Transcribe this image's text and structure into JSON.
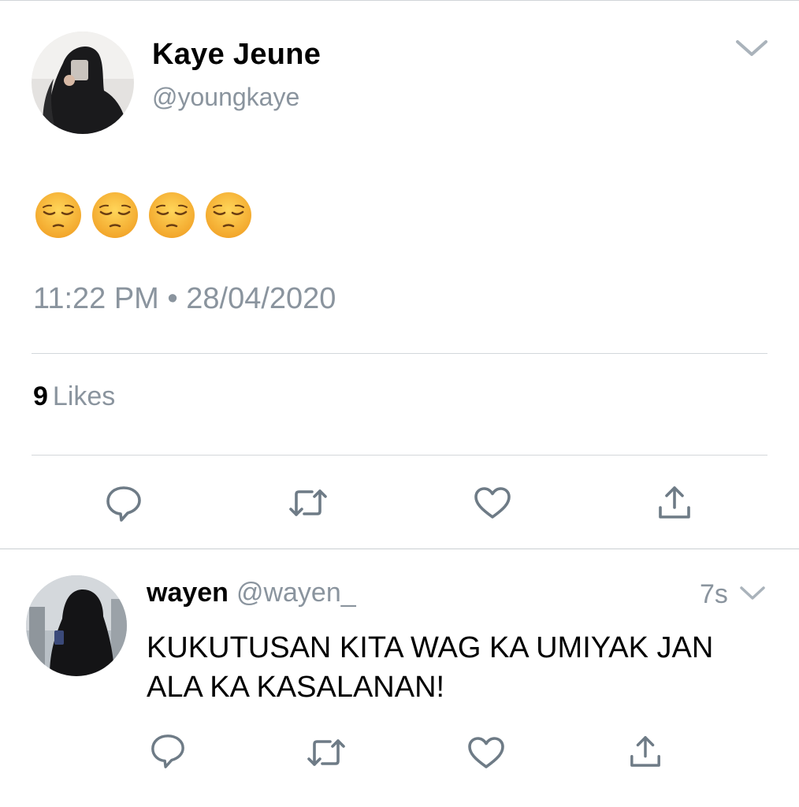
{
  "tweet": {
    "display_name": "Kaye Jeune",
    "handle": "@youngkaye",
    "emojis": [
      "😔",
      "😔",
      "😔",
      "😔"
    ],
    "emoji_icon": "pensive-face-icon",
    "timestamp": "11:22 PM • 28/04/2020",
    "likes_count": "9",
    "likes_label": "Likes",
    "actions": [
      "reply-icon",
      "retweet-icon",
      "like-heart-icon",
      "share-icon"
    ]
  },
  "reply": {
    "display_name": "wayen",
    "handle": "@wayen_",
    "time": "7s",
    "text": "KUKUTUSAN KITA WAG KA UMIYAK JAN ALA KA KASALANAN!",
    "actions": [
      "reply-icon",
      "retweet-icon",
      "like-heart-icon",
      "share-icon"
    ]
  },
  "colors": {
    "secondary_text": "#8a949e",
    "divider": "#d3d7db",
    "icon": "#6e7b86",
    "emoji_face": "#f7b734"
  }
}
